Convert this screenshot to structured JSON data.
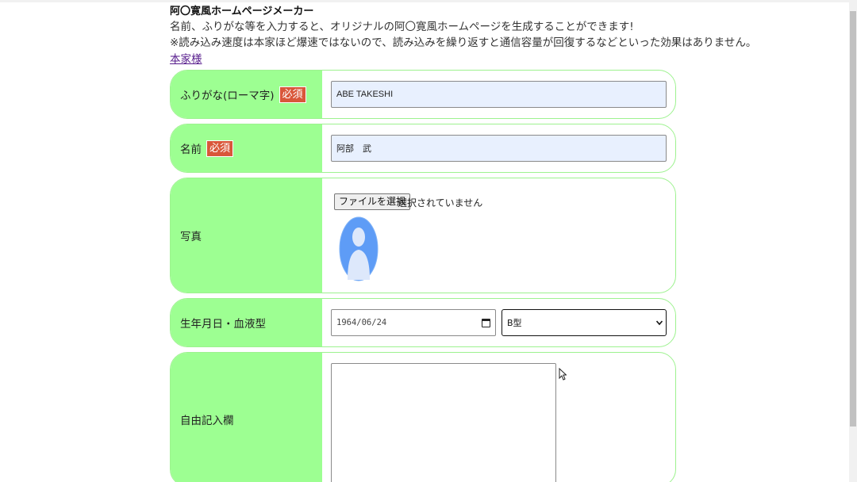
{
  "header": {
    "title": "阿〇寛風ホームページメーカー",
    "description_line1": "名前、ふりがな等を入力すると、オリジナルの阿〇寛風ホームページを生成することができます!",
    "description_line2": "※読み込み速度は本家ほど爆速ではないので、読み込みを繰り返すと通信容量が回復するなどといった効果はありません。",
    "home_link": "本家様"
  },
  "form": {
    "required_badge": "必須",
    "furigana": {
      "label": "ふりがな(ローマ字)",
      "value": "ABE TAKESHI"
    },
    "name": {
      "label": "名前",
      "value": "阿部　武"
    },
    "photo": {
      "label": "写真",
      "button": "ファイルを選択",
      "status": "選択されていません",
      "avatar_icon": "person-silhouette-icon"
    },
    "birth_blood": {
      "label": "生年月日・血液型",
      "date": "1964/06/24",
      "blood_type": "B型"
    },
    "free_text": {
      "label": "自由記入欄",
      "value": ""
    }
  },
  "colors": {
    "label_bg": "#9dff92",
    "row_border": "#9df28f",
    "badge": "#d9573a",
    "input_autofill": "#e8f0fe",
    "avatar": "#5e9cf6"
  }
}
